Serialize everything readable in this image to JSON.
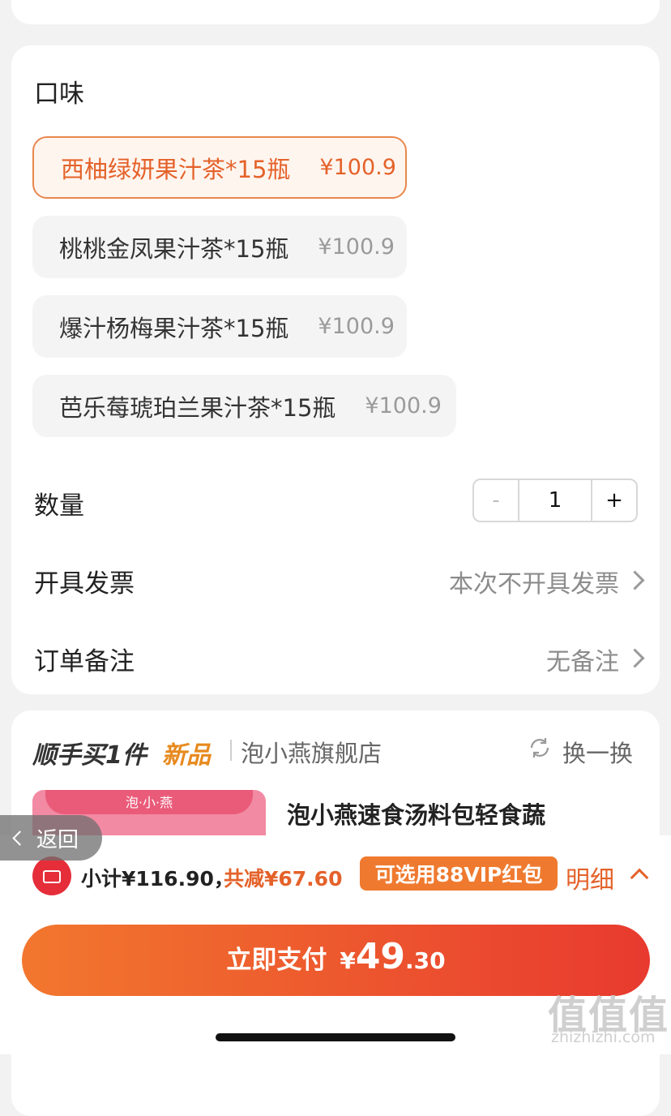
{
  "flavor": {
    "title": "口味",
    "options": [
      {
        "name": "西柚绿妍果汁茶*15瓶",
        "price": "¥100.9",
        "selected": true
      },
      {
        "name": "桃桃金凤果汁茶*15瓶",
        "price": "¥100.9",
        "selected": false
      },
      {
        "name": "爆汁杨梅果汁茶*15瓶",
        "price": "¥100.9",
        "selected": false
      },
      {
        "name": "芭乐莓琥珀兰果汁茶*15瓶",
        "price": "¥100.9",
        "selected": false
      }
    ]
  },
  "quantity": {
    "label": "数量",
    "minus": "-",
    "value": "1",
    "plus": "+"
  },
  "invoice": {
    "label": "开具发票",
    "value": "本次不开具发票"
  },
  "remark": {
    "label": "订单备注",
    "value": "无备注"
  },
  "recommend": {
    "title": "顺手买1件",
    "new_tag": "新品",
    "shop": "泡小燕旗舰店",
    "refresh": "换一换",
    "product_logo": "泡·小·燕",
    "product_name": "泡小燕速食汤料包轻食蔬"
  },
  "back": {
    "label": "返回"
  },
  "summary": {
    "subtotal": "小计¥116.90，",
    "discount": "共减¥67.60",
    "vip": "可选用88VIP红包",
    "detail": "明细"
  },
  "pay": {
    "label": "立即支付",
    "yen": "¥",
    "amount_int": "49",
    "amount_dec": ".30"
  },
  "watermark": {
    "text": "值值值",
    "url": "zhizhizhi.com"
  },
  "colors": {
    "accent": "#e4622a",
    "pay_start": "#f2772e",
    "pay_end": "#e83a2f"
  }
}
